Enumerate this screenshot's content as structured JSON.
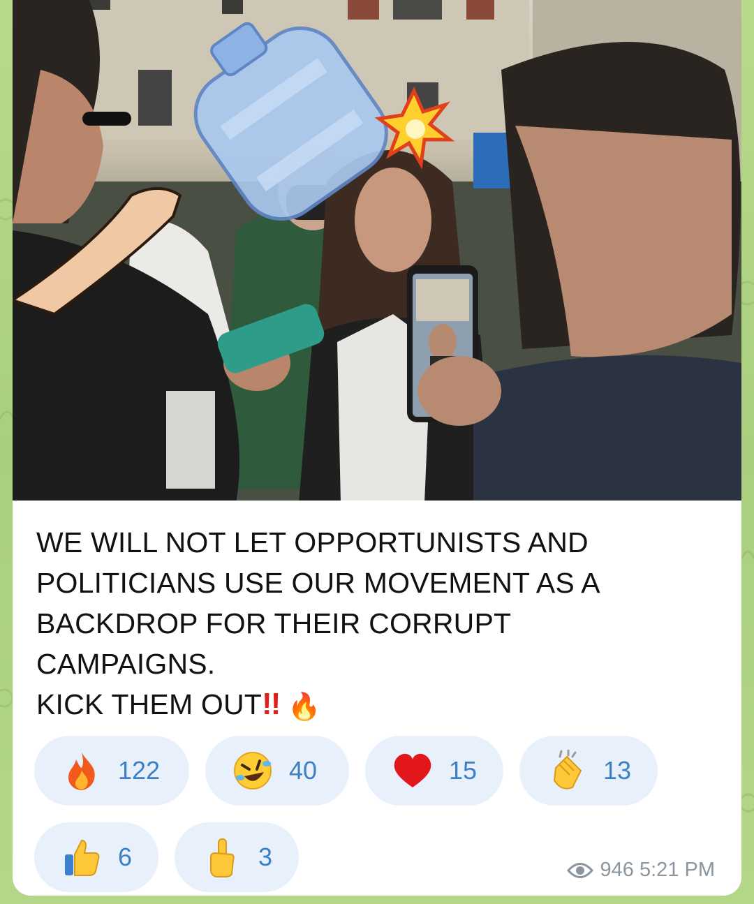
{
  "post": {
    "caption_lines": [
      "WE WILL NOT LET OPPORTUNISTS AND",
      "POLITICIANS USE OUR MOVEMENT AS A",
      "BACKDROP FOR THEIR CORRUPT",
      "CAMPAIGNS."
    ],
    "caption_last_line": "KICK THEM OUT",
    "caption_bang": "!!",
    "caption_emoji": "🔥",
    "views": "946",
    "time": "5:21 PM"
  },
  "reactions": [
    {
      "icon": "fire-icon",
      "count": "122"
    },
    {
      "icon": "rofl-icon",
      "count": "40"
    },
    {
      "icon": "heart-icon",
      "count": "15"
    },
    {
      "icon": "clap-icon",
      "count": "13"
    },
    {
      "icon": "thumbs-up-icon",
      "count": "6"
    },
    {
      "icon": "middle-finger-icon",
      "count": "3"
    }
  ],
  "colors": {
    "accent": "#3b7fc4",
    "reaction_bg": "#e8f1fb",
    "meta": "#8a95a0",
    "bang": "#e0201c"
  }
}
